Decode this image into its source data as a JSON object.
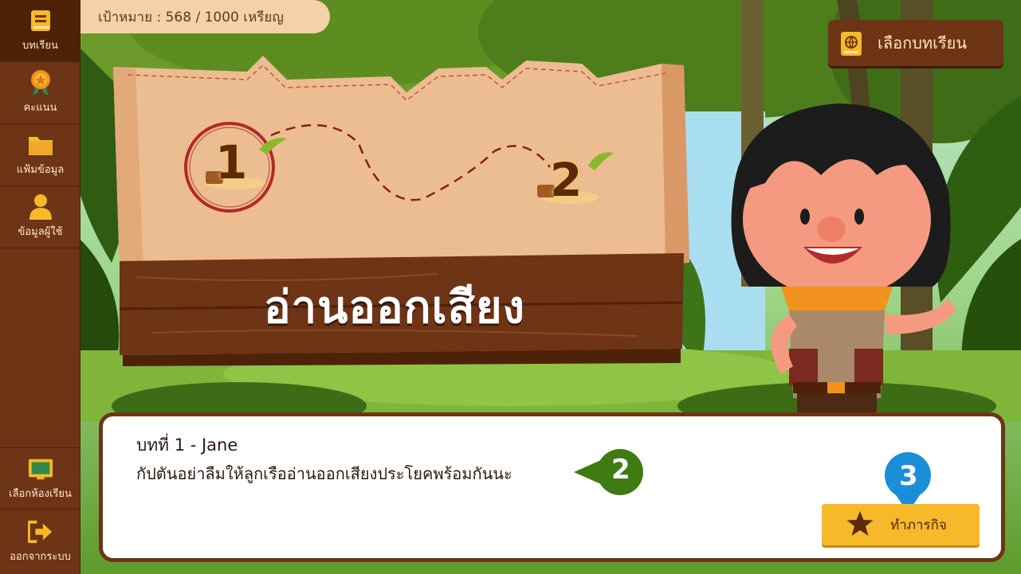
{
  "sidebar": {
    "items": [
      {
        "label": "บทเรียน",
        "icon": "book-icon"
      },
      {
        "label": "คะแนน",
        "icon": "medal-icon"
      },
      {
        "label": "แฟ้มข้อมูล",
        "icon": "folder-icon"
      },
      {
        "label": "ข้อมูลผู้ใช้",
        "icon": "user-icon"
      }
    ],
    "bottom_items": [
      {
        "label": "เลือกห้องเรียน",
        "icon": "classroom-board-icon"
      },
      {
        "label": "ออกจากระบบ",
        "icon": "logout-icon"
      }
    ]
  },
  "goal": {
    "text": "เป้าหมาย : 568 / 1000 เหรียญ"
  },
  "header": {
    "choose_lesson_label": "เลือกบทเรียน",
    "choose_lesson_icon": "globe-book-icon"
  },
  "map": {
    "title": "อ่านออกเสียง",
    "stops": [
      {
        "number": "1",
        "selected": true
      },
      {
        "number": "2",
        "selected": false
      }
    ]
  },
  "dialog": {
    "lesson_name": "บทที่ 1 - Jane",
    "message": "กัปตันอย่าลืมให้ลูกเรืออ่านออกเสียงประโยคพร้อมกันนะ",
    "hint_badge_2": "2",
    "hint_badge_3": "3",
    "mission_label": "ทำภารกิจ",
    "mission_icon": "star-icon"
  },
  "colors": {
    "sidebar": "#6e3416",
    "accent_button": "#f6b92a",
    "badge_green": "#3f7a12",
    "badge_blue": "#1a8fd8",
    "parchment": "#ecbd91"
  }
}
